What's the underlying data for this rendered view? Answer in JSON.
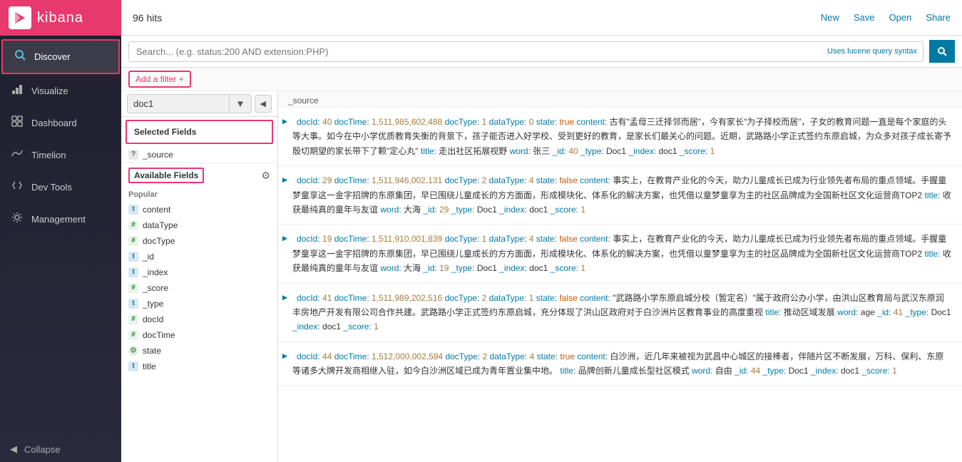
{
  "sidebar": {
    "logo_text": "kibana",
    "logo_short": "K",
    "items": [
      {
        "id": "discover",
        "label": "Discover",
        "icon": "🔍",
        "active": true
      },
      {
        "id": "visualize",
        "label": "Visualize",
        "icon": "📊",
        "active": false
      },
      {
        "id": "dashboard",
        "label": "Dashboard",
        "icon": "📋",
        "active": false
      },
      {
        "id": "timelion",
        "label": "Timelion",
        "icon": "〜",
        "active": false
      },
      {
        "id": "devtools",
        "label": "Dev Tools",
        "icon": "🔧",
        "active": false
      },
      {
        "id": "management",
        "label": "Management",
        "icon": "⚙",
        "active": false
      }
    ],
    "collapse_label": "Collapse"
  },
  "topbar": {
    "hits": "96 hits",
    "new_label": "New",
    "save_label": "Save",
    "open_label": "Open",
    "share_label": "Share"
  },
  "searchbar": {
    "placeholder": "Search... (e.g. status:200 AND extension:PHP)",
    "lucene_hint": "Uses lucene query syntax",
    "search_icon": "🔍"
  },
  "filter": {
    "add_label": "Add a filter +"
  },
  "leftpanel": {
    "index_name": "doc1",
    "selected_fields_label": "Selected Fields",
    "source_field": "_source",
    "available_fields_label": "Available Fields",
    "popular_label": "Popular",
    "fields": [
      {
        "type": "t",
        "name": "content"
      },
      {
        "type": "#",
        "name": "dataType"
      },
      {
        "type": "#",
        "name": "docType"
      },
      {
        "type": "t",
        "name": "_id"
      },
      {
        "type": "t",
        "name": "_index"
      },
      {
        "type": "#",
        "name": "_score"
      },
      {
        "type": "t",
        "name": "_type"
      },
      {
        "type": "#",
        "name": "docId"
      },
      {
        "type": "#",
        "name": "docTime"
      },
      {
        "type": "⊙",
        "name": "state"
      },
      {
        "type": "t",
        "name": "title"
      }
    ]
  },
  "results_header": "_source",
  "results": [
    {
      "id": 1,
      "content": "docId: 40 docTime: 1,511,985,602,488 docType: 1 dataType: 0 state: true content: 古有\"孟母三迁择邻而居\"，今有家长\"为子择校而居\"，子女的教育问题一直是每个家庭的头等大事。如今在中小学优质教育失衡的背景下，孩子能否进入好学校、受到更好的教育，是家长们最关心的问题。近期，武路路小学正式签约东原启城，为众多对孩子成长寄予殷切期望的家长带下了颗\"定心丸\". title: 走出社区拓展视野 word: 张三 _id: 40 _type: Doc1 _index: doc1 _score: 1"
    },
    {
      "id": 2,
      "content": "docId: 29 docTime: 1,511,946,002,131 docType: 2 dataType: 4 state: false content: 事实上，在教育产业化的今天，助力儿童成长已成为行业领先者布局的重点领域。手握童梦童享这一金字招牌的东原集团，早已围绕儿童成长的方方面面，形成模块化、体系化的解决方案，也凭借以童梦童享为主的社区品牌成为全国新社区文化运营商TOP2 title: 收获最纯真的童年与友谊 word: 大海 _id: 29 _type: Doc1 _index: doc1 _score: 1"
    },
    {
      "id": 3,
      "content": "docId: 19 docTime: 1,511,910,001,839 docType: 1 dataType: 4 state: false content: 事实上，在教育产业化的今天，助力儿童成长已成为行业领先者布局的重点领域。手握童梦童享这一金字招牌的东原集团，早已围绕儿童成长的方方面面，形成模块化、体系化的解决方案，也凭借以童梦童享为主的社区品牌成为全国新社区文化运营商TOP2 title: 收获最纯真的童年与友谊 word: 大海 _id: 19 _type: Doc1 _index: doc1 _score: 1"
    },
    {
      "id": 4,
      "content": "docId: 41 docTime: 1,511,989,202,516 docType: 2 dataType: 1 state: false content: \"武路路小学东原启城分校（暂定名）\"属于政府公办小学，由洪山区教育局与武汉东原润丰房地产开发有限公司合作共建。武路路小学正式签约东原启城，充分体现了洪山区政府对于白沙洲片区教育事业的高度重视 title: 推动区域发展 word: age _id: 41 _type: Doc1 _index: doc1 _score: 1"
    },
    {
      "id": 5,
      "content": "docId: 44 docTime: 1,512,000,002,594 docType: 2 dataType: 4 state: true content: 白沙洲，近几年来被视为武昌中心城区的接棒者，伴随片区不断发展，万科、保利、东原等诸多大牌开发商相继入驻，如今白沙洲区域已成为青年置业集中地。 title: 品牌创新儿童成长型社区模式 word: 自由 _id: 44 _type: Doc1 _index: doc1 _score: 1"
    }
  ]
}
